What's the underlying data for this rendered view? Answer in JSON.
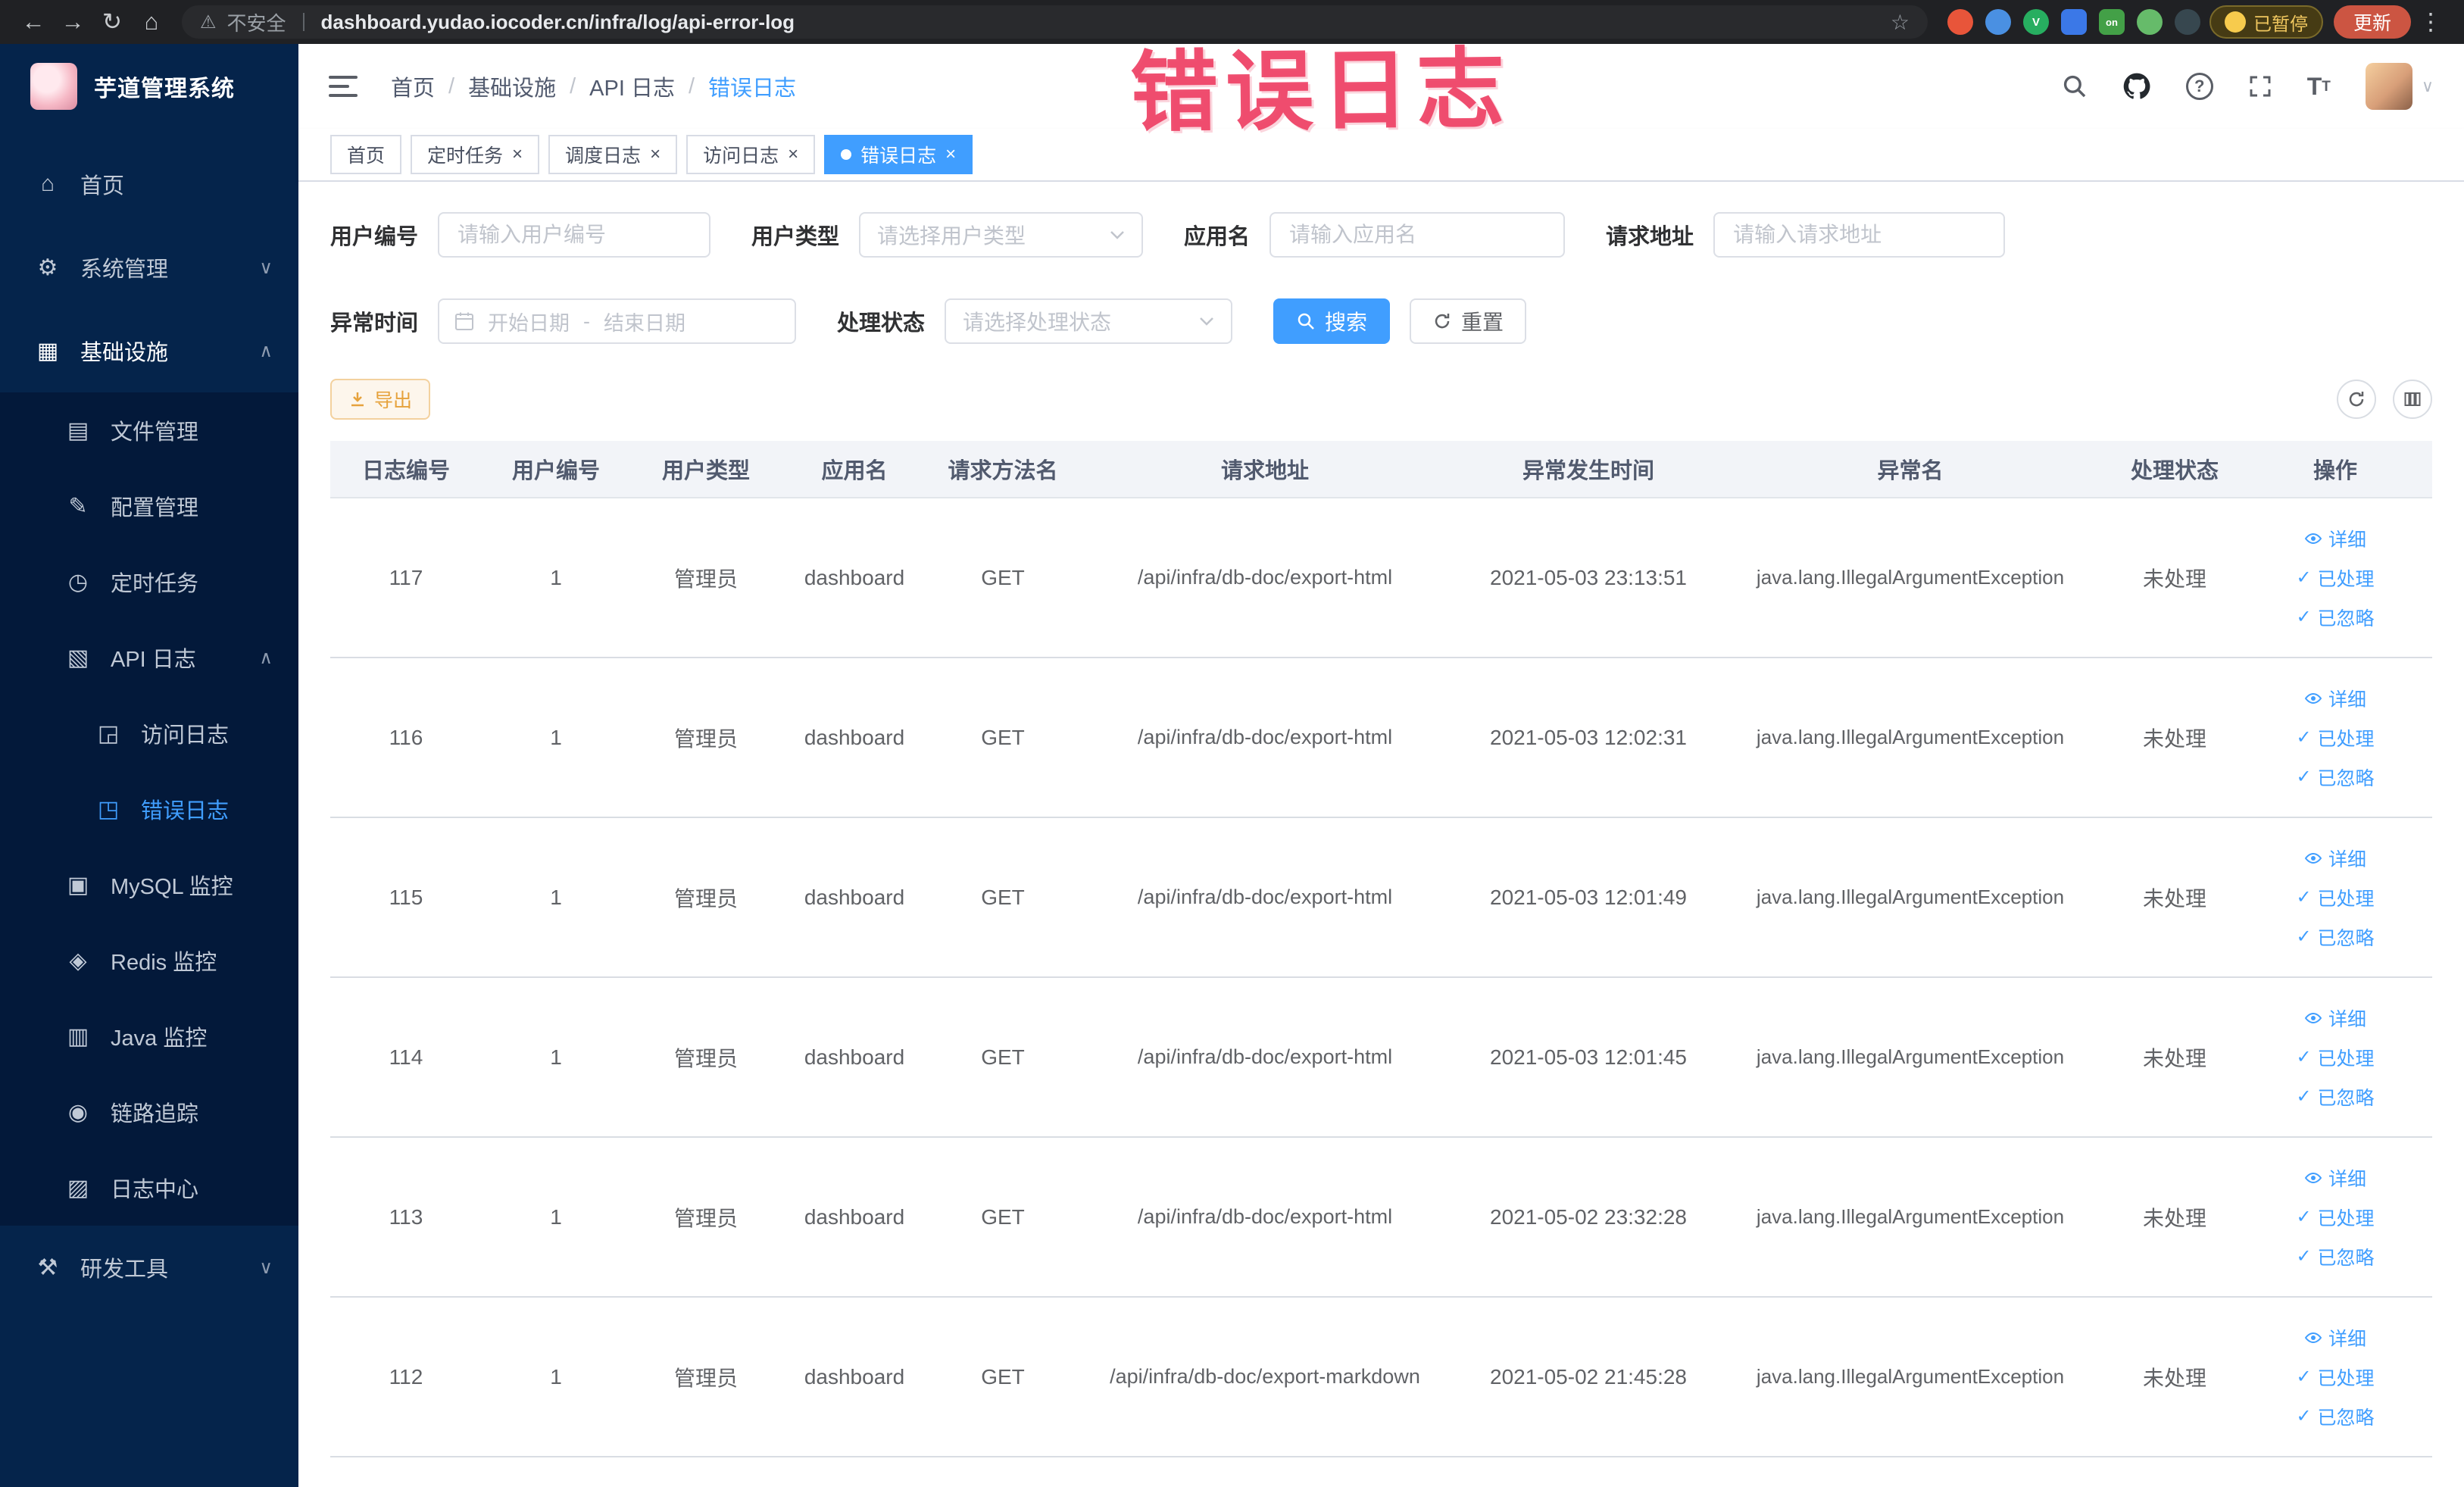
{
  "annotation": {
    "text": "错误日志"
  },
  "browser": {
    "security_label": "不安全",
    "url": "dashboard.yudao.iocoder.cn/infra/log/api-error-log",
    "paused_badge": "已暂停",
    "update_label": "更新"
  },
  "icons": {
    "back": "←",
    "forward": "→",
    "reload": "↻",
    "home": "⌂",
    "warning": "⚠",
    "star": "☆",
    "kebab": "⋮",
    "menu_home": "⌂",
    "gear": "⚙",
    "infra": "▦",
    "file": "▤",
    "config": "✎",
    "timer": "◷",
    "apilog": "▧",
    "accesslog": "◲",
    "errorlog": "◳",
    "mysql": "▣",
    "redis": "◈",
    "java": "▥",
    "trace": "◉",
    "logcenter": "▨",
    "tools": "⚒",
    "chevron_down": "∨",
    "chevron_up": "∧",
    "caret_down": "∨",
    "check": "✓",
    "close": "×",
    "ext_v": "V",
    "ext_on": "on"
  },
  "sidebar": {
    "logo_title": "芋道管理系统",
    "items": [
      {
        "label": "首页"
      },
      {
        "label": "系统管理"
      },
      {
        "label": "基础设施"
      },
      {
        "label": "文件管理"
      },
      {
        "label": "配置管理"
      },
      {
        "label": "定时任务"
      },
      {
        "label": "API 日志"
      },
      {
        "label": "访问日志"
      },
      {
        "label": "错误日志"
      },
      {
        "label": "MySQL 监控"
      },
      {
        "label": "Redis 监控"
      },
      {
        "label": "Java 监控"
      },
      {
        "label": "链路追踪"
      },
      {
        "label": "日志中心"
      },
      {
        "label": "研发工具"
      }
    ]
  },
  "breadcrumb": {
    "items": [
      "首页",
      "基础设施",
      "API 日志",
      "错误日志"
    ],
    "separator": "/"
  },
  "tabs": [
    {
      "label": "首页"
    },
    {
      "label": "定时任务"
    },
    {
      "label": "调度日志"
    },
    {
      "label": "访问日志"
    },
    {
      "label": "错误日志"
    }
  ],
  "filters": {
    "user_id_label": "用户编号",
    "user_id_placeholder": "请输入用户编号",
    "user_type_label": "用户类型",
    "user_type_placeholder": "请选择用户类型",
    "app_name_label": "应用名",
    "app_name_placeholder": "请输入应用名",
    "request_url_label": "请求地址",
    "request_url_placeholder": "请输入请求地址",
    "exception_time_label": "异常时间",
    "start_date_placeholder": "开始日期",
    "date_separator": "-",
    "end_date_placeholder": "结束日期",
    "process_status_label": "处理状态",
    "process_status_placeholder": "请选择处理状态",
    "search_label": "搜索",
    "reset_label": "重置"
  },
  "toolbar": {
    "export_label": "导出"
  },
  "table": {
    "columns": [
      "日志编号",
      "用户编号",
      "用户类型",
      "应用名",
      "请求方法名",
      "请求地址",
      "异常发生时间",
      "异常名",
      "处理状态",
      "操作"
    ],
    "action_labels": {
      "detail": "详细",
      "processed": "已处理",
      "ignored": "已忽略"
    },
    "rows": [
      {
        "id": "117",
        "user_id": "1",
        "user_type": "管理员",
        "app": "dashboard",
        "method": "GET",
        "url": "/api/infra/db-doc/export-html",
        "time": "2021-05-03 23:13:51",
        "exception": "java.lang.IllegalArgumentException",
        "status": "未处理"
      },
      {
        "id": "116",
        "user_id": "1",
        "user_type": "管理员",
        "app": "dashboard",
        "method": "GET",
        "url": "/api/infra/db-doc/export-html",
        "time": "2021-05-03 12:02:31",
        "exception": "java.lang.IllegalArgumentException",
        "status": "未处理"
      },
      {
        "id": "115",
        "user_id": "1",
        "user_type": "管理员",
        "app": "dashboard",
        "method": "GET",
        "url": "/api/infra/db-doc/export-html",
        "time": "2021-05-03 12:01:49",
        "exception": "java.lang.IllegalArgumentException",
        "status": "未处理"
      },
      {
        "id": "114",
        "user_id": "1",
        "user_type": "管理员",
        "app": "dashboard",
        "method": "GET",
        "url": "/api/infra/db-doc/export-html",
        "time": "2021-05-03 12:01:45",
        "exception": "java.lang.IllegalArgumentException",
        "status": "未处理"
      },
      {
        "id": "113",
        "user_id": "1",
        "user_type": "管理员",
        "app": "dashboard",
        "method": "GET",
        "url": "/api/infra/db-doc/export-html",
        "time": "2021-05-02 23:32:28",
        "exception": "java.lang.IllegalArgumentException",
        "status": "未处理"
      },
      {
        "id": "112",
        "user_id": "1",
        "user_type": "管理员",
        "app": "dashboard",
        "method": "GET",
        "url": "/api/infra/db-doc/export-markdown",
        "time": "2021-05-02 21:45:28",
        "exception": "java.lang.IllegalArgumentException",
        "status": "未处理"
      }
    ]
  },
  "colors": {
    "accent": "#409eff",
    "sidebar_bg": "#05244b",
    "annotation": "#ee4064",
    "warning": "#e6a23c"
  }
}
